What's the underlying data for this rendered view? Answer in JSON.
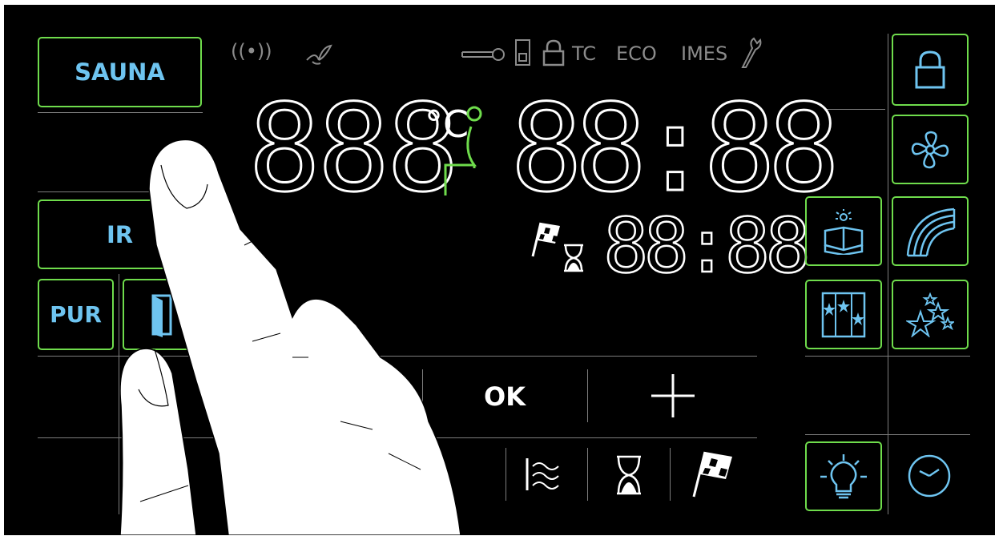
{
  "colors": {
    "background": "#000000",
    "accent_border": "#6fdc4c",
    "icon_blue": "#6ec4f0",
    "segment": "#ffffff",
    "seat": "#6fdc4c",
    "inactive": "#8b8b8b"
  },
  "mode_buttons": {
    "sauna": "SAUNA",
    "ir": "IR",
    "pur": "PUR"
  },
  "status_row": {
    "radio": "((•))",
    "tc": "TC",
    "eco": "ECO",
    "imes": "IMES"
  },
  "display": {
    "temperature": "888",
    "unit": "°C",
    "clock": "88:88",
    "timer": "88:88"
  },
  "controls": {
    "ok": "OK"
  },
  "icons": [
    "radio-signal-icon",
    "butterfly-icon",
    "key-icon",
    "card-slot-icon",
    "padlock-icon",
    "wrench-icon",
    "seat-person-icon",
    "door-icon",
    "finish-flag-icon",
    "hourglass-icon",
    "humidity-icon",
    "lock-icon",
    "fan-icon",
    "reading-light-icon",
    "rainbow-icon",
    "star-panel-icon",
    "stars-icon",
    "light-bulb-icon",
    "clock-icon",
    "plus-icon"
  ]
}
